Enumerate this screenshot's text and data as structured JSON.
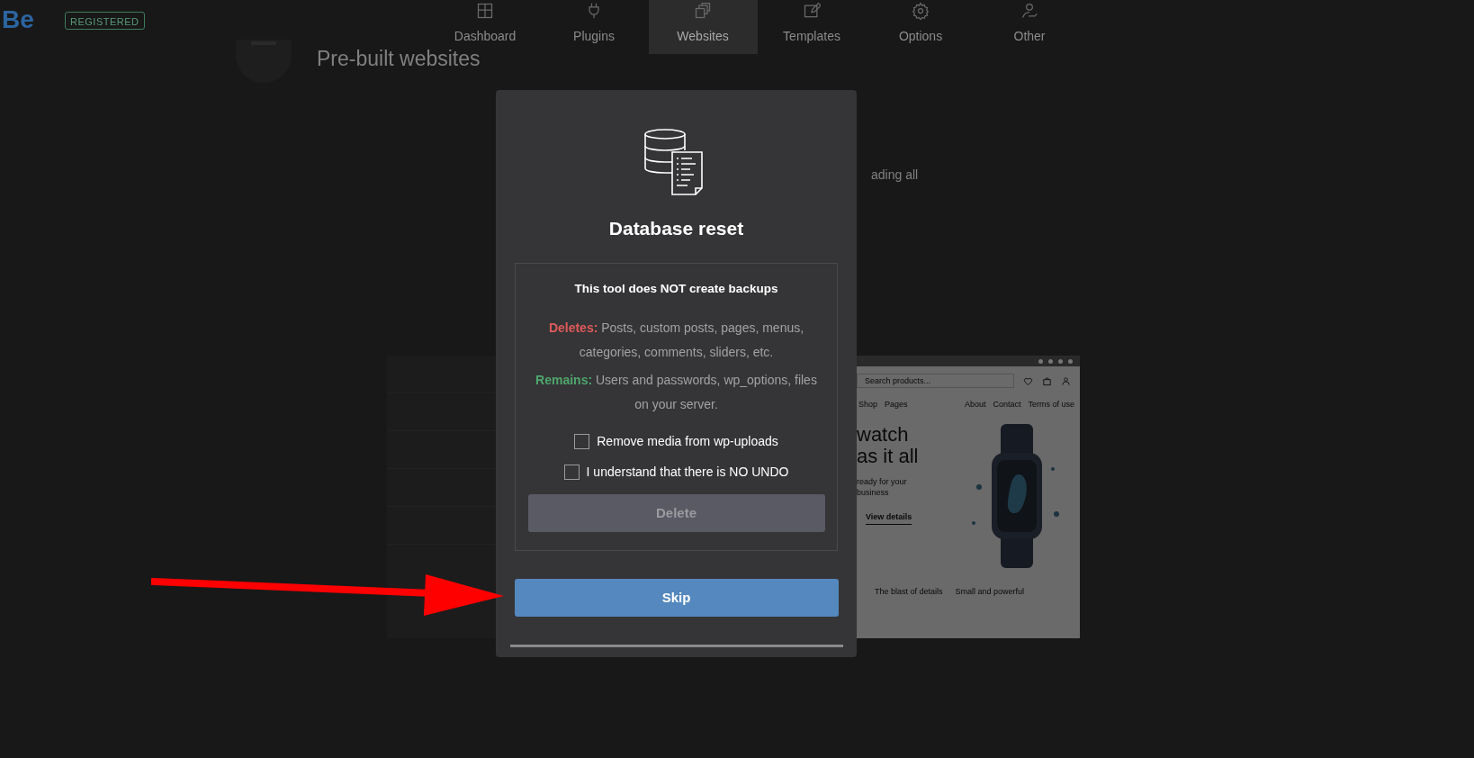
{
  "header": {
    "logo": "Be",
    "badge": "REGISTERED",
    "nav": [
      {
        "label": "Dashboard",
        "selected": false
      },
      {
        "label": "Plugins",
        "selected": false
      },
      {
        "label": "Websites",
        "selected": true
      },
      {
        "label": "Templates",
        "selected": false
      },
      {
        "label": "Options",
        "selected": false
      },
      {
        "label": "Other",
        "selected": false
      }
    ]
  },
  "page": {
    "title": "Pre-built websites",
    "intro_fragment": "ading all"
  },
  "preview": {
    "search_placeholder": "Search products...",
    "menu_left": [
      "Shop",
      "Pages"
    ],
    "menu_right": [
      "About",
      "Contact",
      "Terms of use"
    ],
    "headline": [
      "watch",
      "as it all"
    ],
    "subtext": [
      "ready for your",
      "business"
    ],
    "link": "View details",
    "tabs": [
      "The blast of details",
      "Small and powerful"
    ]
  },
  "dialog": {
    "title": "Database reset",
    "warning": "This tool does NOT create backups",
    "notes": [
      {
        "label": "Deletes:",
        "text": "Posts, custom posts, pages, menus, categories, comments, sliders, etc.",
        "color": "#e05a5a"
      },
      {
        "label": "Remains:",
        "text": "Users and passwords, wp_options, files on your server.",
        "color": "#4ea66c"
      }
    ],
    "options": [
      {
        "label": "Remove media from wp-uploads",
        "checked": false
      },
      {
        "label": "I understand that there is NO UNDO",
        "checked": false
      }
    ],
    "delete_button": {
      "label": "Delete",
      "disabled": true
    },
    "skip_button": {
      "label": "Skip"
    }
  },
  "annotation": {
    "kind": "arrow"
  }
}
